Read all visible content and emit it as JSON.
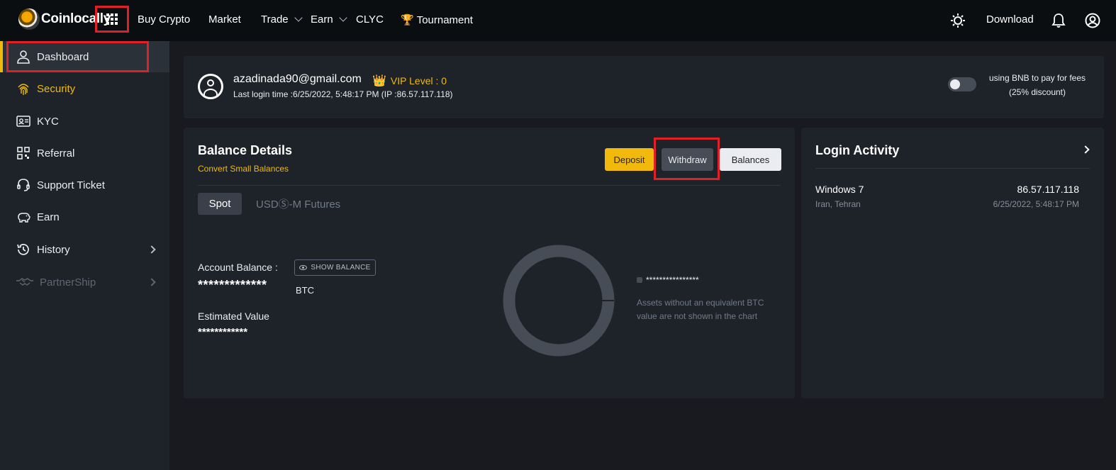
{
  "nav": {
    "logo_text": "Coinlocally",
    "items": [
      "Buy Crypto",
      "Market",
      "Trade",
      "Earn",
      "CLYC",
      "Tournament"
    ],
    "download": "Download"
  },
  "sidebar": {
    "items": [
      {
        "label": "Dashboard"
      },
      {
        "label": "Security"
      },
      {
        "label": "KYC"
      },
      {
        "label": "Referral"
      },
      {
        "label": "Support Ticket"
      },
      {
        "label": "Earn"
      },
      {
        "label": "History"
      },
      {
        "label": "PartnerShip"
      }
    ]
  },
  "profile": {
    "email": "azadinada90@gmail.com",
    "vip": "VIP Level : 0",
    "last_login": "Last login time :6/25/2022, 5:48:17 PM (IP :86.57.117.118)",
    "bnb_line1": "using BNB to pay for fees",
    "bnb_line2": "(25% discount)",
    "bnb_toggle_on": false
  },
  "balance": {
    "title": "Balance Details",
    "convert": "Convert Small Balances",
    "deposit": "Deposit",
    "withdraw": "Withdraw",
    "balances": "Balances",
    "tabs": [
      "Spot",
      "USDⓈ-M Futures"
    ],
    "account_label": "Account Balance :",
    "show_balance": "SHOW BALANCE",
    "account_mask": "*************",
    "account_unit": "BTC",
    "estimated_label": "Estimated Value",
    "estimated_mask": "************",
    "legend_mask": "****************",
    "note": "Assets without an equivalent BTC value are not shown in the chart",
    "colors": {
      "accent": "#f0b90b",
      "donut": "#474d57"
    }
  },
  "login_activity": {
    "title": "Login Activity",
    "entries": [
      {
        "os": "Windows 7",
        "ip": "86.57.117.118",
        "location": "Iran, Tehran",
        "time": "6/25/2022, 5:48:17 PM"
      }
    ]
  },
  "icons": [
    "apps-grid-icon",
    "sun-icon",
    "bell-icon",
    "account-icon",
    "trophy-icon",
    "crown-icon",
    "eye-icon"
  ]
}
